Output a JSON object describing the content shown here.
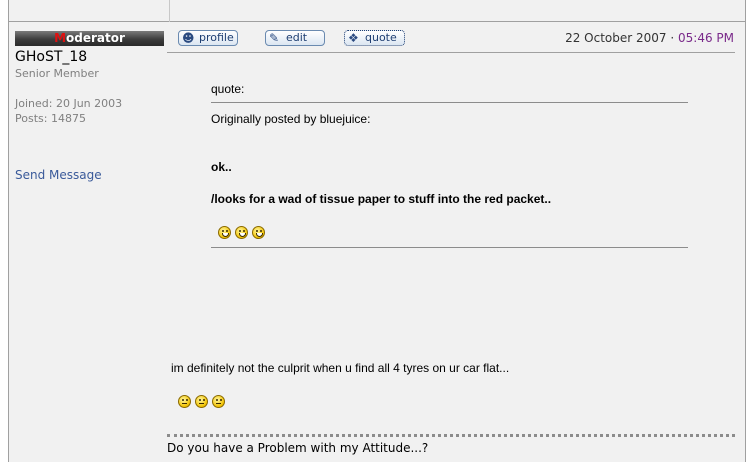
{
  "user": {
    "rank_badge_first": "M",
    "rank_badge_rest": "oderator",
    "username": "GHoST_18",
    "title": "Senior Member",
    "joined": "Joined: 20 Jun 2003",
    "posts": "Posts: 14875",
    "send_message": "Send Message"
  },
  "post_actions": {
    "profile": "profile",
    "edit": "edit",
    "quote": "quote"
  },
  "post_meta": {
    "date": "22 October 2007",
    "separator": " · ",
    "time": "05:46 PM"
  },
  "quote": {
    "label": "quote:",
    "author_line": "Originally posted by bluejuice:",
    "lines": [
      "ok..",
      "/looks for a wad of tissue paper to stuff into the red packet.."
    ],
    "smileys": [
      "happy",
      "happy",
      "happy"
    ]
  },
  "body": {
    "text": "im definitely not the culprit when u find all 4 tyres on ur car flat...",
    "smileys": [
      "sad",
      "sad",
      "sad"
    ]
  },
  "signature": {
    "text": "Do you have a Problem with my Attitude...?"
  },
  "colors": {
    "panel_bg": "#f1f1f1",
    "link": "#3a5a9a",
    "time": "#7a2a8a",
    "badge_first_letter": "#e01010"
  }
}
